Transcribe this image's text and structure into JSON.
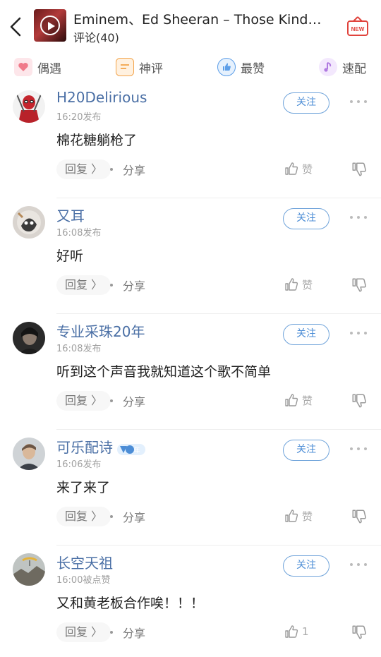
{
  "header": {
    "song_title": "Eminem、Ed Sheeran – Those Kinda...",
    "comment_count": "评论(40)",
    "new_badge": "NEW"
  },
  "tabs": [
    {
      "label": "偶遇",
      "icon": "heart-icon",
      "color": "#f07a8a"
    },
    {
      "label": "神评",
      "icon": "chat-lines-icon",
      "color": "#f3a44b"
    },
    {
      "label": "最赞",
      "icon": "thumbs-up-icon",
      "color": "#5c9ee8"
    },
    {
      "label": "速配",
      "icon": "music-note-icon",
      "color": "#b07ae0"
    }
  ],
  "follow_label": "关注",
  "actions": {
    "reply": "回复 〉",
    "share": "分享",
    "like": "赞"
  },
  "vip_badge_text": "年",
  "comments": [
    {
      "user": "H20Delirious",
      "time": "16:20发布",
      "text": "棉花糖躺枪了",
      "likes": "赞"
    },
    {
      "user": "又耳",
      "time": "16:08发布",
      "text": "好听",
      "likes": "赞"
    },
    {
      "user": "专业采珠20年",
      "time": "16:08发布",
      "text": "听到这个声音我就知道这个歌不简单",
      "likes": "赞"
    },
    {
      "user": "可乐配诗",
      "time": "16:06发布",
      "text": "来了来了",
      "likes": "赞"
    },
    {
      "user": "长空天祖",
      "time": "16:00被点赞",
      "text": "又和黄老板合作唉！！！",
      "likes": "1"
    }
  ],
  "colors": {
    "accent": "#4c8dd6",
    "username": "#4a6fa5"
  }
}
